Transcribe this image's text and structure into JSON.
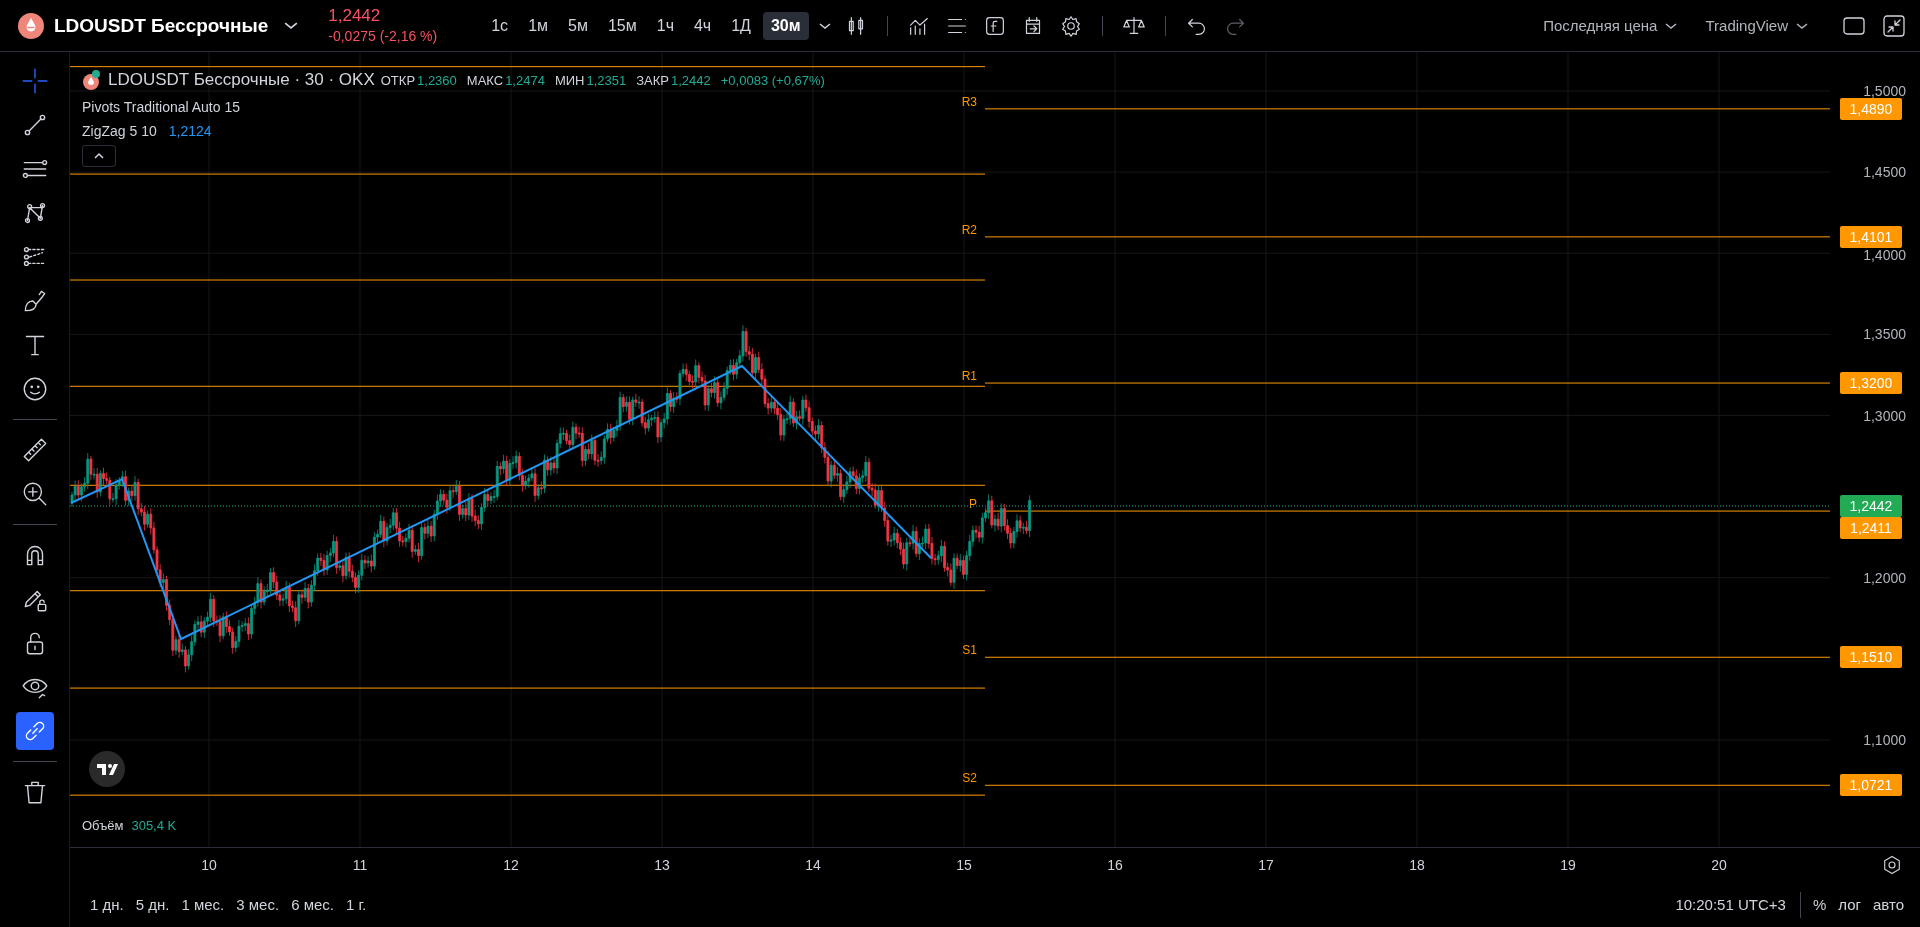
{
  "header": {
    "symbol": "LDOUSDT Бессрочные",
    "price": "1,2442",
    "change": "-0,0275 (-2,16 %)",
    "intervals": [
      {
        "label": "1с",
        "selected": false
      },
      {
        "label": "1м",
        "selected": false
      },
      {
        "label": "5м",
        "selected": false
      },
      {
        "label": "15м",
        "selected": false
      },
      {
        "label": "1ч",
        "selected": false
      },
      {
        "label": "4ч",
        "selected": false
      },
      {
        "label": "1Д",
        "selected": false
      },
      {
        "label": "30м",
        "selected": true
      }
    ],
    "redo_disabled": true,
    "price_source": "Последняя цена",
    "layout_name": "TradingView"
  },
  "tools": [
    {
      "kind": "cursor",
      "selected": true
    },
    {
      "kind": "tool",
      "selected": false
    },
    {
      "kind": "tool",
      "selected": false
    },
    {
      "kind": "tool",
      "selected": false
    },
    {
      "kind": "tool",
      "selected": false
    },
    {
      "kind": "tool",
      "selected": false
    },
    {
      "kind": "tool",
      "selected": false
    },
    {
      "kind": "tool",
      "selected": false
    },
    {
      "kind": "divider"
    },
    {
      "kind": "tool",
      "selected": false
    },
    {
      "kind": "tool",
      "selected": false
    },
    {
      "kind": "divider"
    },
    {
      "kind": "toggle",
      "selected": false
    },
    {
      "kind": "toggle",
      "selected": false
    },
    {
      "kind": "toggle",
      "selected": false
    },
    {
      "kind": "toggle",
      "selected": false
    },
    {
      "kind": "toggle",
      "selected": true
    },
    {
      "kind": "divider"
    },
    {
      "kind": "tool",
      "selected": false
    }
  ],
  "legend": {
    "title": "LDOUSDT Бессрочные · 30 · OKX",
    "ohlc": [
      {
        "label": "ОТКР",
        "value": "1,2360"
      },
      {
        "label": "МАКС",
        "value": "1,2474"
      },
      {
        "label": "МИН",
        "value": "1,2351"
      },
      {
        "label": "ЗАКР",
        "value": "1,2442"
      }
    ],
    "change": "+0,0083 (+0,67%)",
    "indicators": [
      {
        "name": "Pivots Traditional Auto 15"
      },
      {
        "name": "ZigZag 5 10",
        "value": "1,2124"
      }
    ]
  },
  "pivots": [
    {
      "label": "R3",
      "price": "1,4890"
    },
    {
      "label": "R2",
      "price": "1,4101"
    },
    {
      "label": "R1",
      "price": "1,3200"
    },
    {
      "label": "P",
      "price": "1,2411"
    },
    {
      "label": "S1",
      "price": "1,1510"
    },
    {
      "label": "S2",
      "price": "1,0721"
    }
  ],
  "price_axis": {
    "ticks": [
      "1,5000",
      "1,4500",
      "1,4000",
      "1,3500",
      "1,3000",
      "1,2000",
      "1,1000"
    ],
    "last_price": "1,2442"
  },
  "volume": {
    "label": "Объём",
    "value": "305,4 K"
  },
  "time_axis": [
    "10",
    "11",
    "12",
    "13",
    "14",
    "15",
    "16",
    "17",
    "18",
    "19",
    "20"
  ],
  "ranges": [
    "1 дн.",
    "5 дн.",
    "1 мес.",
    "3 мес.",
    "6 мес.",
    "1 г."
  ],
  "clock": "10:20:51 UTC+3",
  "scale_options": [
    "%",
    "лог",
    "авто"
  ]
}
